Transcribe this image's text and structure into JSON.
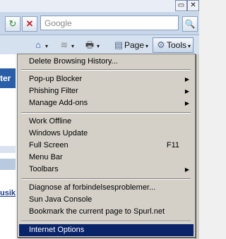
{
  "window": {
    "restore_symbol": "▭",
    "close_symbol": "✕"
  },
  "navbar": {
    "refresh_icon": "↻",
    "stop_icon": "✕",
    "search_placeholder": "Google",
    "search_icon": "🔍"
  },
  "commandbar": {
    "home_icon": "⌂",
    "feeds_icon": "≋",
    "print_icon": "🖶",
    "page_label": "Page",
    "tools_label": "Tools",
    "dropdown_glyph": "▾"
  },
  "background_page": {
    "header_fragment": "ter",
    "link_fragment": "usik"
  },
  "menu": {
    "items": [
      {
        "label": "Delete Browsing History..."
      },
      {
        "label": "Pop-up Blocker",
        "submenu": true
      },
      {
        "label": "Phishing Filter",
        "submenu": true
      },
      {
        "label": "Manage Add-ons",
        "submenu": true
      },
      {
        "label": "Work Offline"
      },
      {
        "label": "Windows Update"
      },
      {
        "label": "Full Screen",
        "shortcut": "F11"
      },
      {
        "label": "Menu Bar"
      },
      {
        "label": "Toolbars",
        "submenu": true
      },
      {
        "label": "Diagnose af forbindelsesproblemer..."
      },
      {
        "label": "Sun Java Console"
      },
      {
        "label": "Bookmark the current page to Spurl.net"
      },
      {
        "label": "Internet Options",
        "selected": true
      }
    ],
    "submenu_arrow": "▶"
  },
  "colors": {
    "selection": "#0a246a",
    "menu_bg": "#d4d0c8",
    "nav_bg": "#c9d7ea"
  }
}
